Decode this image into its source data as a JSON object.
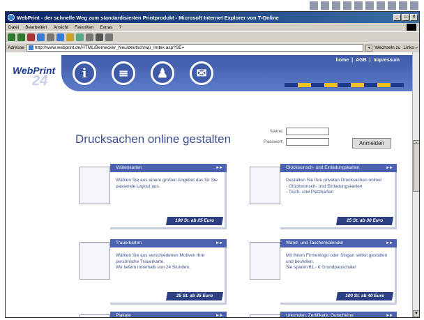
{
  "window": {
    "title": "WebPrint - der schnelle Weg zum standardisierten Printprodukt - Microsoft Internet Explorer von T-Online",
    "buttons": [
      "_",
      "□",
      "×"
    ]
  },
  "menu": [
    "Datei",
    "Bearbeiten",
    "Ansicht",
    "Favoriten",
    "Extras",
    "?"
  ],
  "address": {
    "label": "Adresse",
    "url": "http://www.webprint.de/HTML/Bernecker_Neu/deutsch/wp_Index.asp?SE=",
    "go_label": "Wechseln zu",
    "links_label": "Links »"
  },
  "site": {
    "logo": "WebPrint",
    "logo_number": "24",
    "nav_links": [
      "home",
      "|",
      "AGB",
      "|",
      "Impressum"
    ],
    "headline": "Drucksachen online gestalten",
    "login": {
      "name_label": "Name:",
      "password_label": "Passwort:",
      "button": "Anmelden"
    },
    "colorbar": [
      "#1f3c8c",
      "#f0c020",
      "#1f3c8c",
      "#f0c020",
      "#1f3c8c",
      "#f0c020",
      "#1f3c8c",
      "#f0c020",
      "#1f3c8c"
    ]
  },
  "cards": [
    {
      "title": "Visitenkarten",
      "text": "Wählen Sie aus einem großen Angebot das für Sie passende Layout aus.",
      "price": "100 St. ab 25 Euro"
    },
    {
      "title": "Glückwunsch- und Einladungskarten",
      "text": "Gestalten Sie Ihre privaten Drucksachen online!\n- Glückwunsch- und Einladungskarten\n- Tisch- und Platzkarten",
      "price": "25 St. ab 30 Euro"
    },
    {
      "title": "Trauerkarten",
      "text": "Wählen Sie aus verschiedenen Motiven Ihre persönliche Trauerkarte.\nWir liefern innerhalb von 24 Stunden.",
      "price": "25 St. ab 35 Euro"
    },
    {
      "title": "Wand- und Taschenkalender",
      "text": "Mit Ihrem Firmenlogo oder Slogan selbst gestalten und bestellen.\nSie sparen 61,- € Grundpauschale!",
      "price": "100 St. ab 40 Euro"
    },
    {
      "title": "Plakate",
      "text": "",
      "price": ""
    },
    {
      "title": "Urkunden, Zertifikate, Gutscheine",
      "text": "",
      "price": ""
    }
  ],
  "card_arrows": "►►"
}
